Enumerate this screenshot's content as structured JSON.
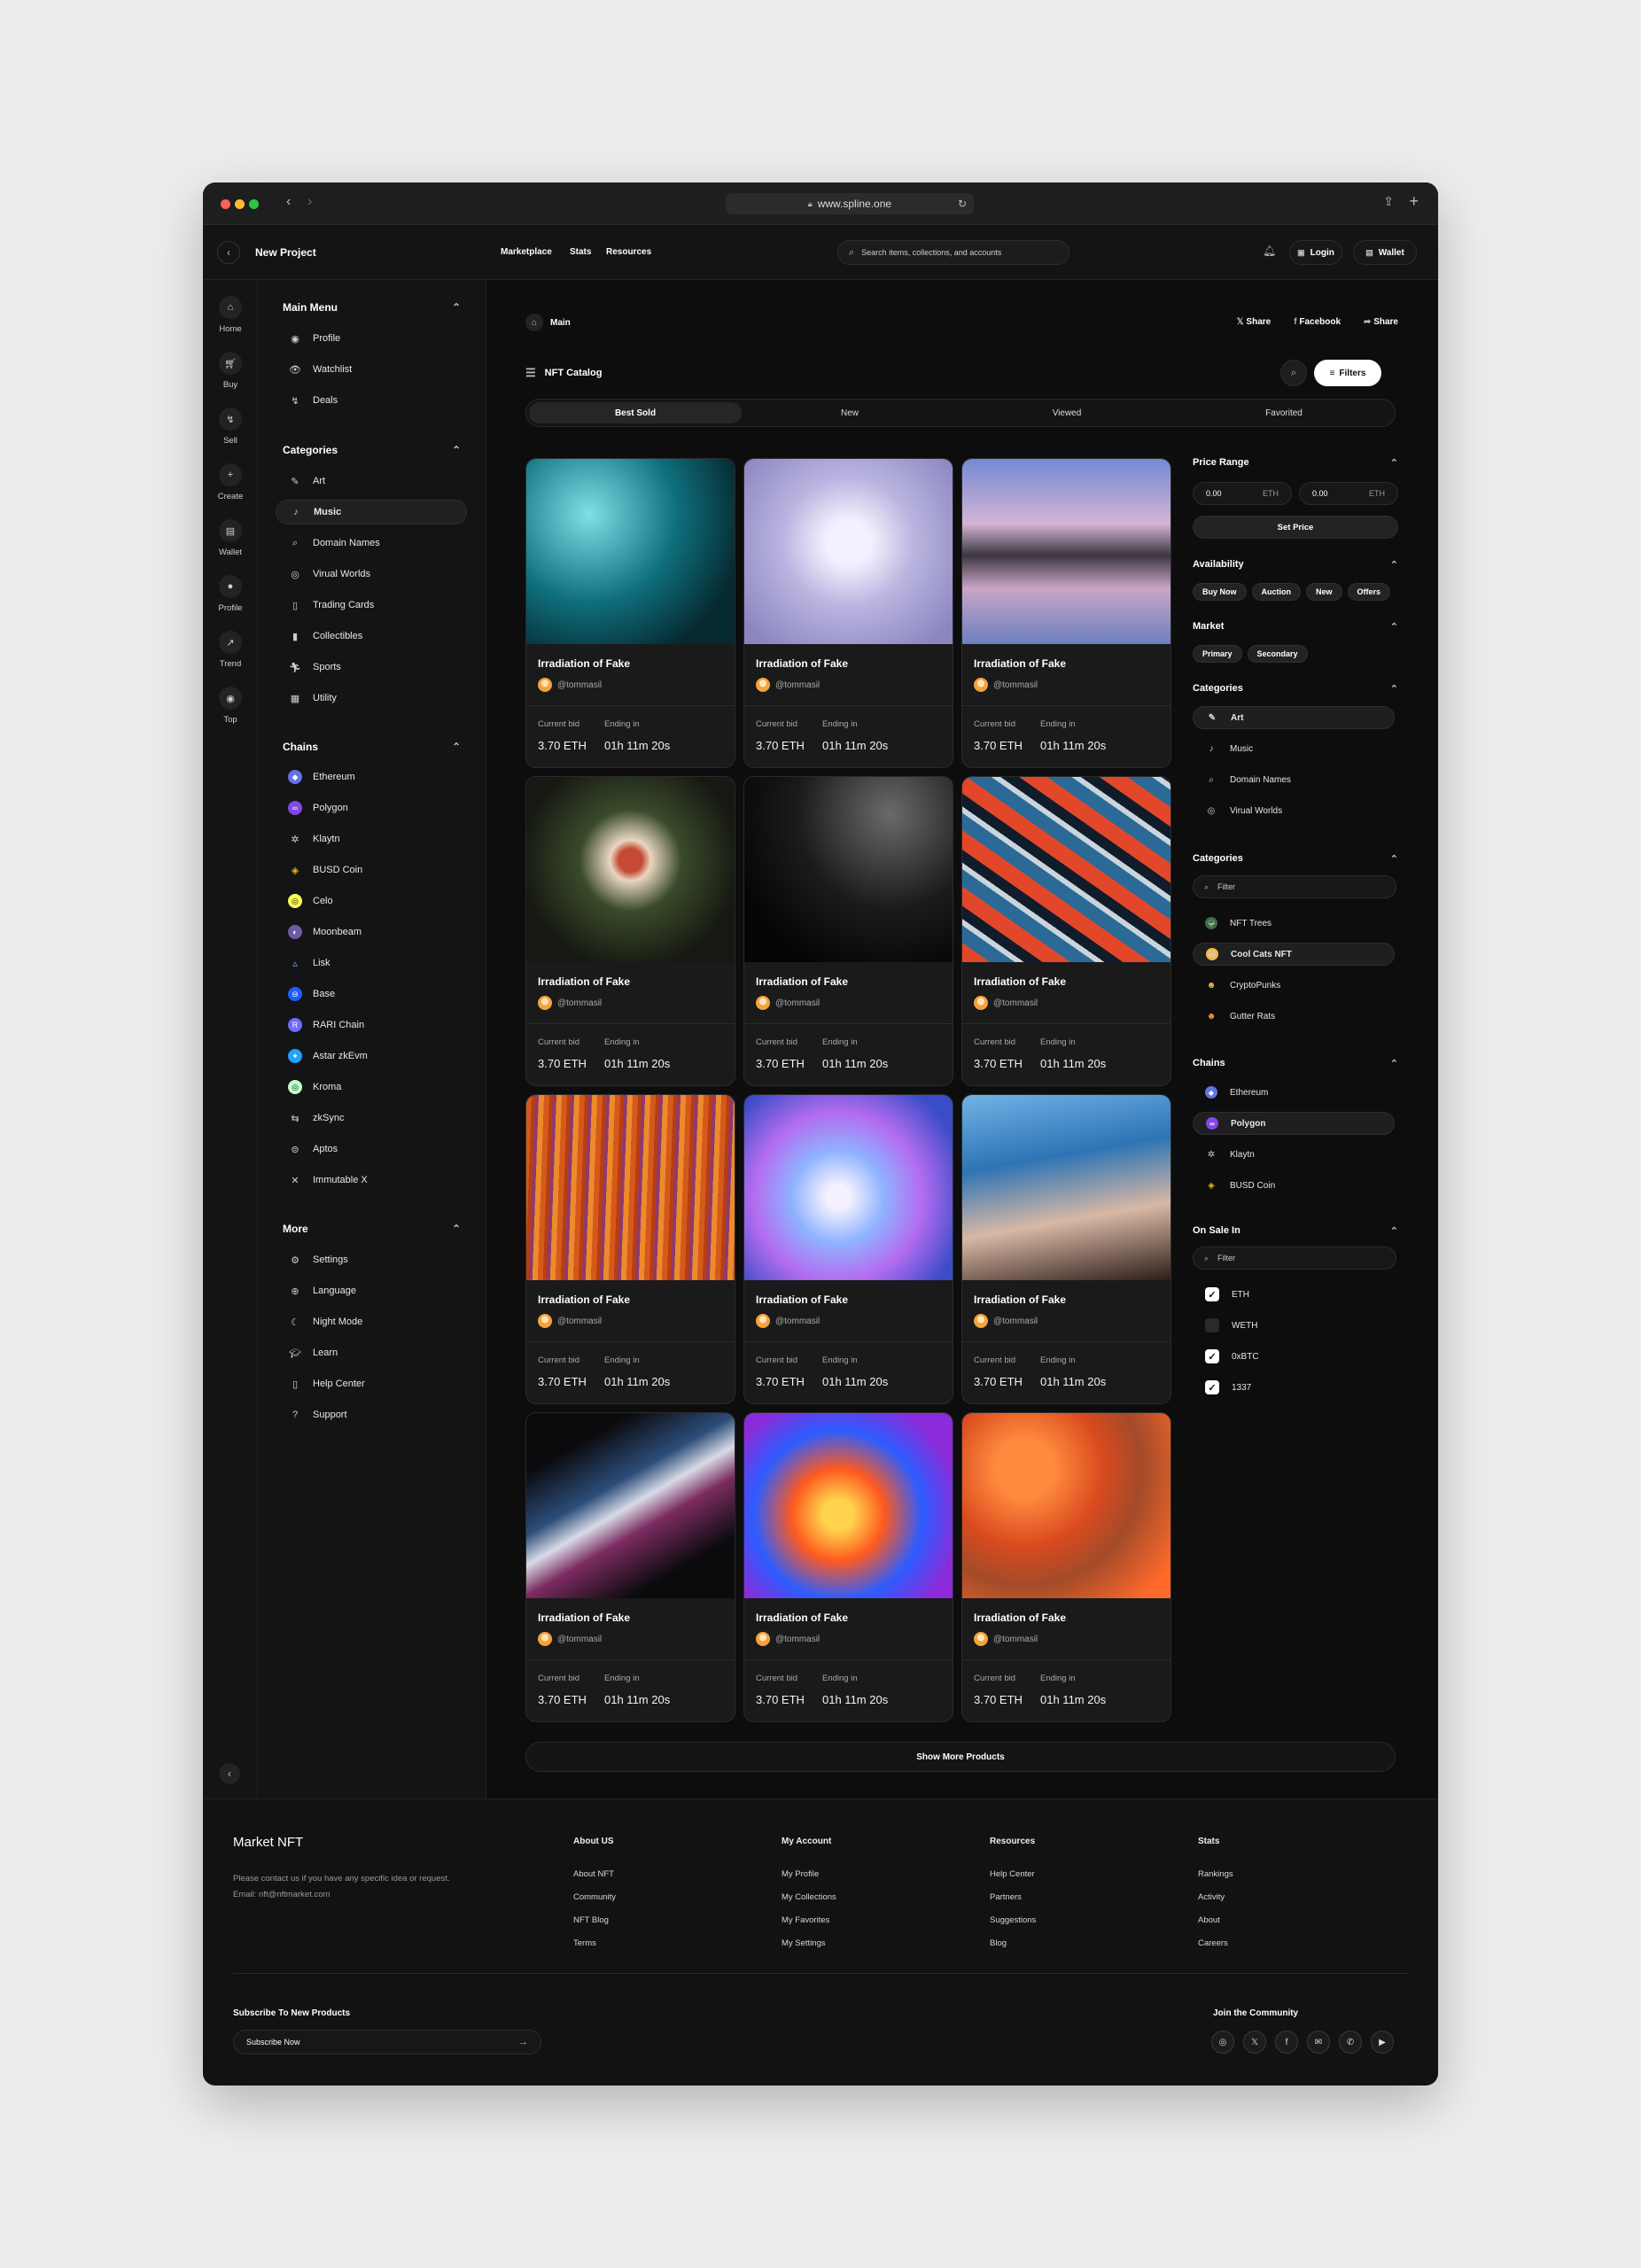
{
  "browser": {
    "url": "www.spline.one"
  },
  "topbar": {
    "project_title": "New Project",
    "nav": [
      "Marketplace",
      "Stats",
      "Resources"
    ],
    "search_placeholder": "Search items, collections, and accounts",
    "login_label": "Login",
    "wallet_label": "Wallet"
  },
  "mini_nav": [
    "Home",
    "Buy",
    "Sell",
    "Create",
    "Wallet",
    "Profile",
    "Trend",
    "Top"
  ],
  "sidebar": {
    "main_menu_title": "Main Menu",
    "main_menu": [
      "Profile",
      "Watchlist",
      "Deals"
    ],
    "categories_title": "Categories",
    "categories": [
      "Art",
      "Music",
      "Domain Names",
      "Virual Worlds",
      "Trading Cards",
      "Collectibles",
      "Sports",
      "Utility"
    ],
    "active_category": "Music",
    "chains_title": "Chains",
    "chains": [
      "Ethereum",
      "Polygon",
      "Klaytn",
      "BUSD Coin",
      "Celo",
      "Moonbeam",
      "Lisk",
      "Base",
      "RARI Chain",
      "Astar zkEvm",
      "Kroma",
      "zkSync",
      "Aptos",
      "Immutable X"
    ],
    "more_title": "More",
    "more": [
      "Settings",
      "Language",
      "Night Mode",
      "Learn",
      "Help Center",
      "Support"
    ]
  },
  "main": {
    "breadcrumb": "Main",
    "share_actions": [
      "Share",
      "Facebook",
      "Share"
    ],
    "catalog_title": "NFT Catalog",
    "filters_label": "Filters",
    "tabs": [
      "Best Sold",
      "New",
      "Viewed",
      "Favorited"
    ],
    "active_tab": "Best Sold",
    "show_more": "Show More Products"
  },
  "cards": {
    "title": "Irradiation of Fake",
    "user": "@tommasil",
    "bid_label": "Current bid",
    "bid_value": "3.70 ETH",
    "end_label": "Ending in",
    "end_value": "01h 11m 20s"
  },
  "filters": {
    "price_range_title": "Price Range",
    "min_value": "0.00",
    "max_value": "0.00",
    "currency": "ETH",
    "set_price": "Set Price",
    "availability_title": "Availability",
    "availability": [
      "Buy Now",
      "Auction",
      "New",
      "Offers"
    ],
    "market_title": "Market",
    "market": [
      "Primary",
      "Secondary"
    ],
    "categories_title": "Categories",
    "categories": [
      "Art",
      "Music",
      "Domain Names",
      "Virual Worlds"
    ],
    "collections_title": "Categories",
    "filter_placeholder": "Filter",
    "collections": [
      "NFT Trees",
      "Cool Cats NFT",
      "CryptoPunks",
      "Gutter Rats"
    ],
    "chains_title": "Chains",
    "chains": [
      "Ethereum",
      "Polygon",
      "Klaytn",
      "BUSD Coin"
    ],
    "on_sale_title": "On Sale In",
    "on_sale": [
      "ETH",
      "WETH",
      "0xBTC",
      "1337"
    ]
  },
  "footer": {
    "brand": "Market NFT",
    "blurb": "Please contact us if you have any specific idea or request.",
    "email": "Email: nft@nftmarket.com",
    "cols": [
      {
        "title": "About US",
        "links": [
          "About NFT",
          "Community",
          "NFT Blog",
          "Terms"
        ]
      },
      {
        "title": "My Account",
        "links": [
          "My Profile",
          "My Collections",
          "My Favorites",
          "My Settings"
        ]
      },
      {
        "title": "Resources",
        "links": [
          "Help Center",
          "Partners",
          "Suggestions",
          "Blog"
        ]
      },
      {
        "title": "Stats",
        "links": [
          "Rankings",
          "Activity",
          "About",
          "Careers"
        ]
      }
    ],
    "subscribe_title": "Subscribe To New Products",
    "subscribe_placeholder": "Subscribe Now",
    "community_title": "Join the Community"
  }
}
